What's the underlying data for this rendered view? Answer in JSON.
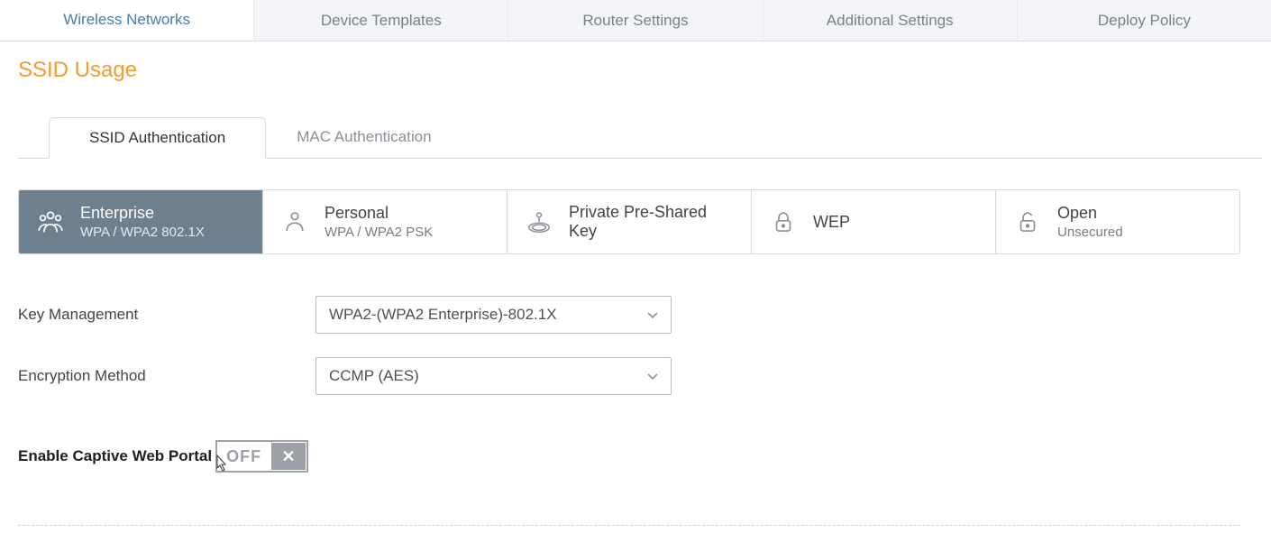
{
  "topTabs": {
    "wireless": "Wireless Networks",
    "templates": "Device Templates",
    "router": "Router Settings",
    "additional": "Additional Settings",
    "deploy": "Deploy Policy"
  },
  "sectionTitle": "SSID Usage",
  "subTabs": {
    "ssidAuth": "SSID Authentication",
    "macAuth": "MAC Authentication"
  },
  "authCards": {
    "enterprise": {
      "title": "Enterprise",
      "sub": "WPA / WPA2 802.1X"
    },
    "personal": {
      "title": "Personal",
      "sub": "WPA / WPA2 PSK"
    },
    "ppsk": {
      "title": "Private Pre-Shared Key",
      "sub": ""
    },
    "wep": {
      "title": "WEP",
      "sub": ""
    },
    "open": {
      "title": "Open",
      "sub": "Unsecured"
    }
  },
  "form": {
    "keyMgmtLabel": "Key Management",
    "keyMgmtValue": "WPA2-(WPA2 Enterprise)-802.1X",
    "encMethodLabel": "Encryption Method",
    "encMethodValue": "CCMP (AES)"
  },
  "captive": {
    "label": "Enable Captive Web Portal",
    "state": "OFF"
  }
}
